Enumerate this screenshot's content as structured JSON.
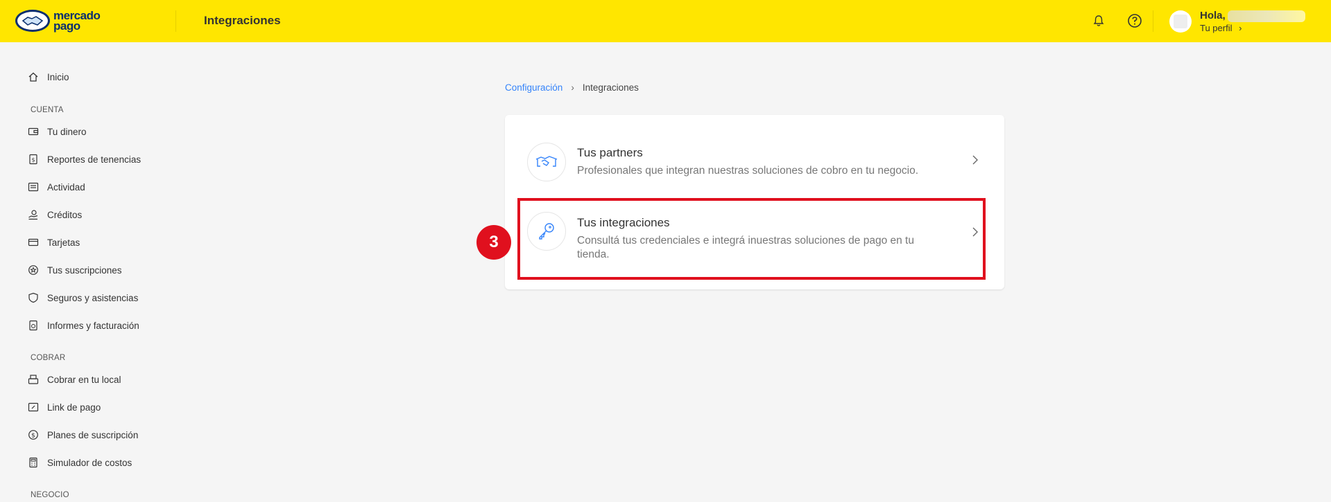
{
  "header": {
    "logo_line1": "mercado",
    "logo_line2": "pago",
    "title": "Integraciones",
    "greeting": "Hola,",
    "profile_link": "Tu perfil"
  },
  "sidebar": {
    "home": "Inicio",
    "sections": {
      "cuenta": "CUENTA",
      "cobrar": "COBRAR",
      "negocio": "NEGOCIO"
    },
    "cuenta_items": [
      "Tu dinero",
      "Reportes de tenencias",
      "Actividad",
      "Créditos",
      "Tarjetas",
      "Tus suscripciones",
      "Seguros y asistencias",
      "Informes y facturación"
    ],
    "cobrar_items": [
      "Cobrar en tu local",
      "Link de pago",
      "Planes de suscripción",
      "Simulador de costos"
    ]
  },
  "breadcrumb": {
    "parent": "Configuración",
    "separator": "›",
    "current": "Integraciones"
  },
  "cards": [
    {
      "title": "Tus partners",
      "description": "Profesionales que integran nuestras soluciones de cobro en tu negocio.",
      "icon": "handshake-icon"
    },
    {
      "title": "Tus integraciones",
      "description": "Consultá tus credenciales e integrá inuestras soluciones de pago en tu tienda.",
      "icon": "key-icon"
    }
  ],
  "annotation": {
    "step_number": "3",
    "color": "#e0101e"
  },
  "colors": {
    "header_bg": "#ffe600",
    "link": "#3483fa",
    "brand_dark": "#0a2f6e"
  }
}
